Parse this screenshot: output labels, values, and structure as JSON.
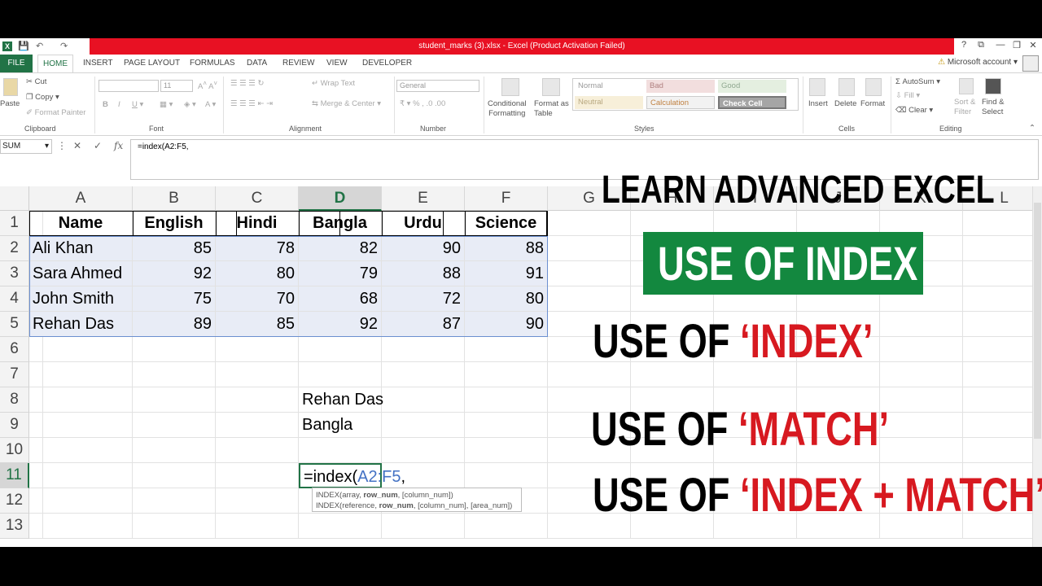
{
  "window": {
    "title": "student_marks (3).xlsx -  Excel (Product Activation Failed)",
    "account": "Microsoft account",
    "controls": [
      "?",
      "⧉",
      "—",
      "❐",
      "✕"
    ]
  },
  "tabs": [
    "FILE",
    "HOME",
    "INSERT",
    "PAGE LAYOUT",
    "FORMULAS",
    "DATA",
    "REVIEW",
    "VIEW",
    "DEVELOPER"
  ],
  "ribbon": {
    "clipboard": {
      "paste": "Paste",
      "cut": "Cut",
      "copy": "Copy",
      "format_painter": "Format Painter",
      "group": "Clipboard"
    },
    "font": {
      "size": "11",
      "group": "Font"
    },
    "alignment": {
      "wrap": "Wrap Text",
      "merge": "Merge & Center",
      "group": "Alignment"
    },
    "number": {
      "format": "General",
      "group": "Number"
    },
    "conditional": [
      "Conditional",
      "Formatting"
    ],
    "format_table": [
      "Format as",
      "Table"
    ],
    "styles": {
      "normal": "Normal",
      "bad": "Bad",
      "good": "Good",
      "neutral": "Neutral",
      "calculation": "Calculation",
      "check_cell": "Check Cell",
      "group": "Styles"
    },
    "cells": {
      "insert": "Insert",
      "delete": "Delete",
      "format": "Format",
      "group": "Cells"
    },
    "editing": {
      "autosum": "AutoSum",
      "fill": "Fill",
      "clear": "Clear",
      "sort": [
        "Sort &",
        "Filter"
      ],
      "find": [
        "Find &",
        "Select"
      ],
      "group": "Editing"
    }
  },
  "formula_bar": {
    "name_box": "SUM",
    "fx": "fx",
    "formula": "=index(A2:F5,"
  },
  "columns": [
    "A",
    "B",
    "C",
    "D",
    "E",
    "F",
    "G",
    "H",
    "I",
    "J",
    "K",
    "L"
  ],
  "rows": [
    "1",
    "2",
    "3",
    "4",
    "5",
    "6",
    "7",
    "8",
    "9",
    "10",
    "11",
    "12",
    "13"
  ],
  "table": {
    "headers": [
      "Name",
      "English",
      "Hindi",
      "Bangla",
      "Urdu",
      "Science"
    ],
    "data": [
      [
        "Ali Khan",
        "85",
        "78",
        "82",
        "90",
        "88"
      ],
      [
        "Sara Ahmed",
        "92",
        "80",
        "79",
        "88",
        "91"
      ],
      [
        "John Smith",
        "75",
        "70",
        "68",
        "72",
        "80"
      ],
      [
        "Rehan Das",
        "89",
        "85",
        "92",
        "87",
        "90"
      ]
    ]
  },
  "extra_cells": {
    "d8": "Rehan Das",
    "d9": "Bangla",
    "d11_prefix": "=index(",
    "d11_ref": "A2:F5",
    "d11_suffix": ","
  },
  "tooltip": {
    "line1": {
      "a": "INDEX(array, ",
      "b": "row_num",
      "c": ", [column_num])"
    },
    "line2": {
      "a": "INDEX(reference, ",
      "b": "row_num",
      "c": ", [column_num], [area_num])"
    }
  },
  "overlay": {
    "heading": "LEARN ADVANCED EXCEL",
    "banner": "USE OF INDEX",
    "line1_prefix": "USE OF ",
    "line1_accent": "‘INDEX’",
    "line2_prefix": "USE OF ",
    "line2_accent": "‘MATCH’",
    "line3_prefix": "USE OF ",
    "line3_accent": "‘INDEX + MATCH’"
  },
  "colors": {
    "excel_green": "#217346",
    "title_red": "#e81123",
    "banner_green": "#13883f",
    "accent_red": "#d71920",
    "selection": "#e8ecf6"
  }
}
